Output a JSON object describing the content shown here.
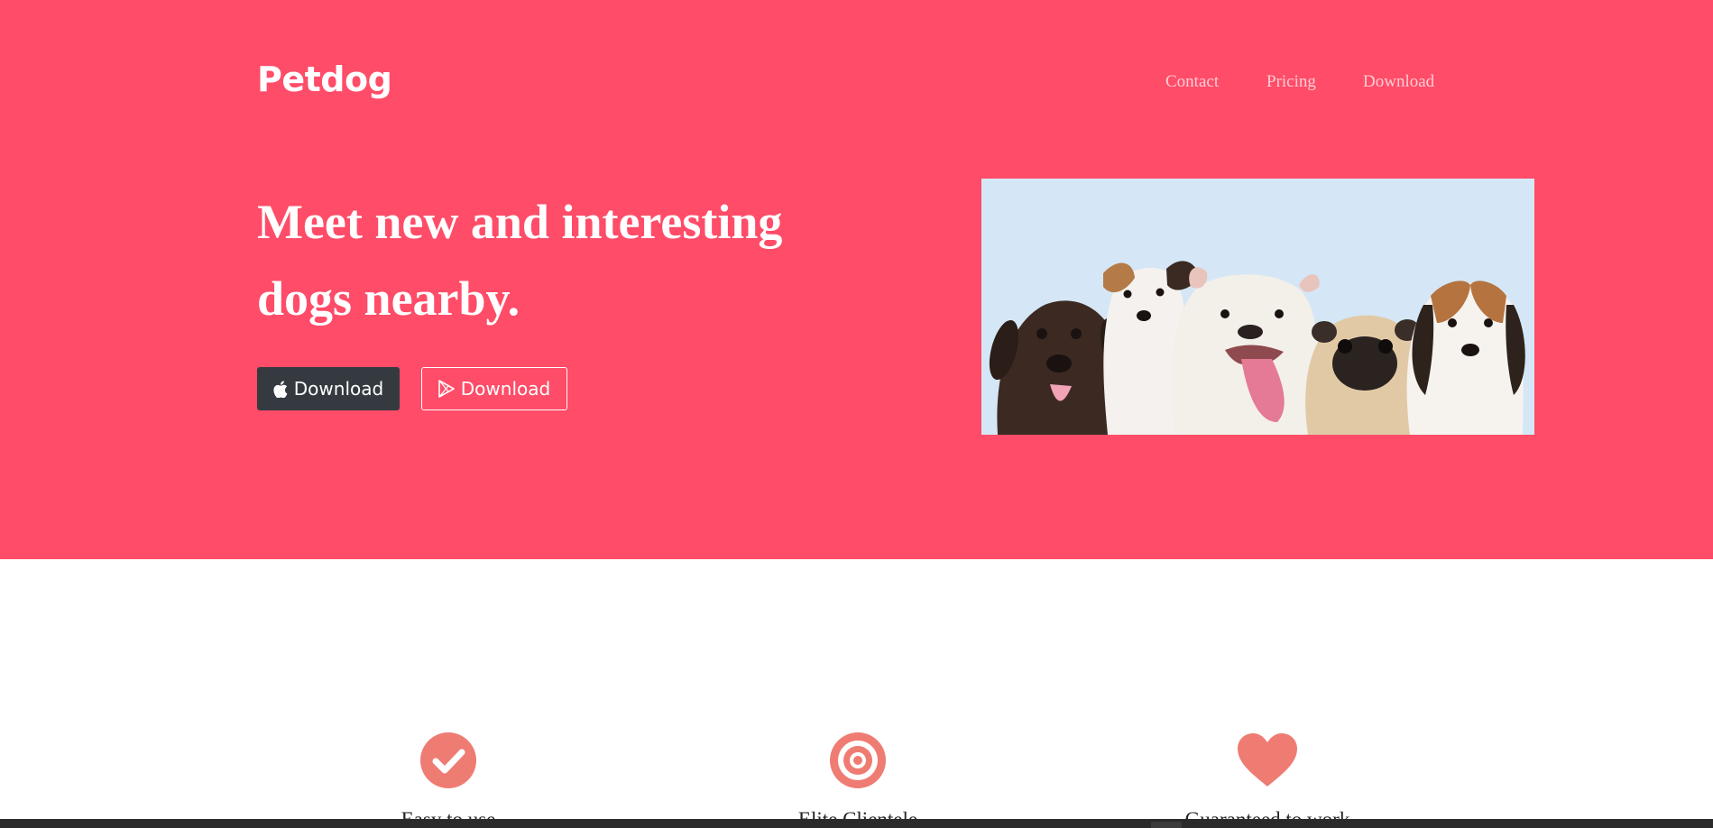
{
  "brand": {
    "name": "Petdog"
  },
  "nav": {
    "items": [
      "Contact",
      "Pricing",
      "Download"
    ]
  },
  "hero": {
    "headline_line1": "Meet new and interesting",
    "headline_line2": "dogs nearby.",
    "buttons": [
      {
        "label": "Download",
        "icon": "apple-icon",
        "style": "dark"
      },
      {
        "label": "Download",
        "icon": "google-play-icon",
        "style": "outline"
      }
    ],
    "image": {
      "subject": "five puppies on light blue background"
    }
  },
  "features": [
    {
      "icon": "check-circle-icon",
      "title": "Easy to use"
    },
    {
      "icon": "bullseye-icon",
      "title": "Elite Clientele"
    },
    {
      "icon": "heart-icon",
      "title": "Guaranteed to work"
    }
  ],
  "colors": {
    "hero_background": "#ff4c68",
    "feature_icon": "#ef7c73",
    "dark_button": "#343a40"
  }
}
